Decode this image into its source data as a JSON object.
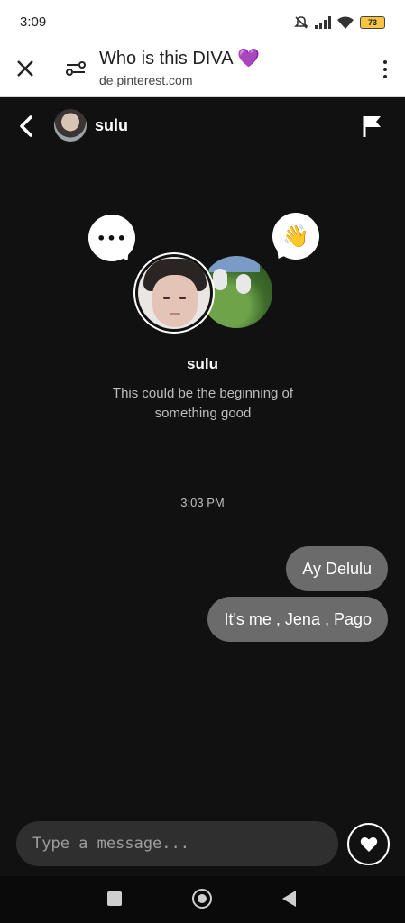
{
  "status_bar": {
    "time": "3:09",
    "battery": "73",
    "icons": [
      "mute-icon",
      "signal-icon",
      "wifi-icon",
      "battery-icon"
    ]
  },
  "browser": {
    "title": "Who is this DIVA 💜",
    "url": "de.pinterest.com",
    "icons": [
      "close-icon",
      "site-settings-icon",
      "more-vert-icon"
    ]
  },
  "chat_header": {
    "name": "sulu",
    "icons": [
      "back-chevron-icon",
      "flag-icon"
    ]
  },
  "intro": {
    "name": "sulu",
    "subtitle": "This could be the beginning of something good",
    "bubble_left": "•••",
    "bubble_right": "👋"
  },
  "conversation": {
    "timestamp": "3:03 PM",
    "messages": [
      {
        "text": "Ay Delulu",
        "sender": "me"
      },
      {
        "text": "It's me , Jena , Pago",
        "sender": "me"
      }
    ]
  },
  "composer": {
    "placeholder": "Type a message...",
    "value": ""
  },
  "colors": {
    "background": "#111111",
    "bubble_sent": "#6b6b6b",
    "composer_bg": "#2f2f2f",
    "battery": "#f6c343"
  },
  "nav_bar": {
    "icons": [
      "recent-apps-icon",
      "home-icon",
      "back-icon"
    ]
  }
}
